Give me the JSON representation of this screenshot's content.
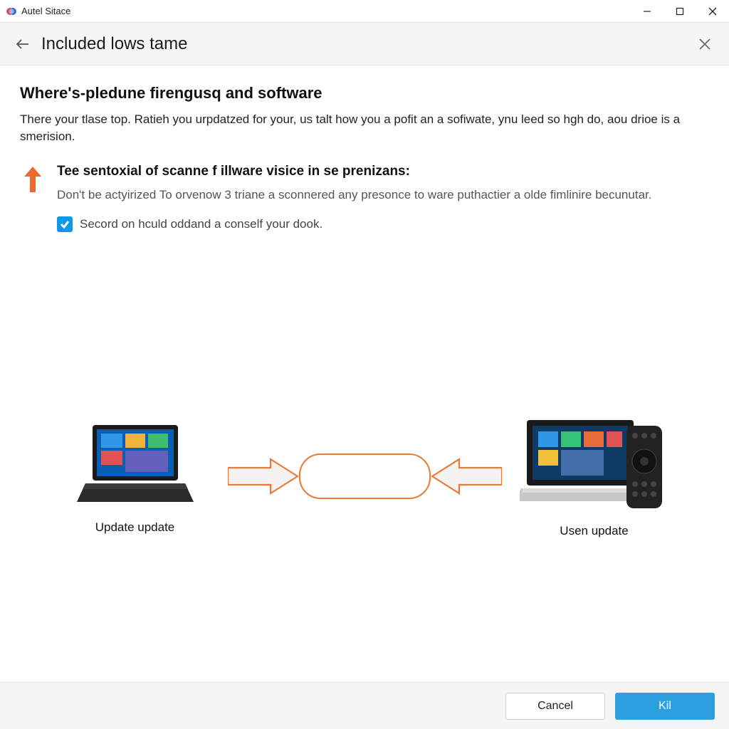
{
  "titlebar": {
    "app_name": "Autel Sitace"
  },
  "header": {
    "page_title": "Included lows tame"
  },
  "content": {
    "heading": "Where's-pledune firengusq and software",
    "intro": "There your tlase top. Ratieh you urpdatzed for your, us talt how you a pofit an a sofiwate, ynu leed so hgh do, aou drioe is a smerision.",
    "note_title": "Tee sentoxial of scanne f illware visice in se prenizans:",
    "note_body": "Don't be actyirized To orvenow 3 triane a sconnered any presonce to ware puthactier a olde fimlinire becunutar.",
    "checkbox_label": "Secord on hculd oddand a conself your dook."
  },
  "diagram": {
    "left_label": "Update\\n update",
    "right_label": "Usen update"
  },
  "footer": {
    "cancel": "Cancel",
    "primary": "Kil"
  },
  "colors": {
    "accent_orange": "#e77a3c",
    "accent_blue": "#2b9fe0",
    "check_blue": "#0f98e8"
  }
}
